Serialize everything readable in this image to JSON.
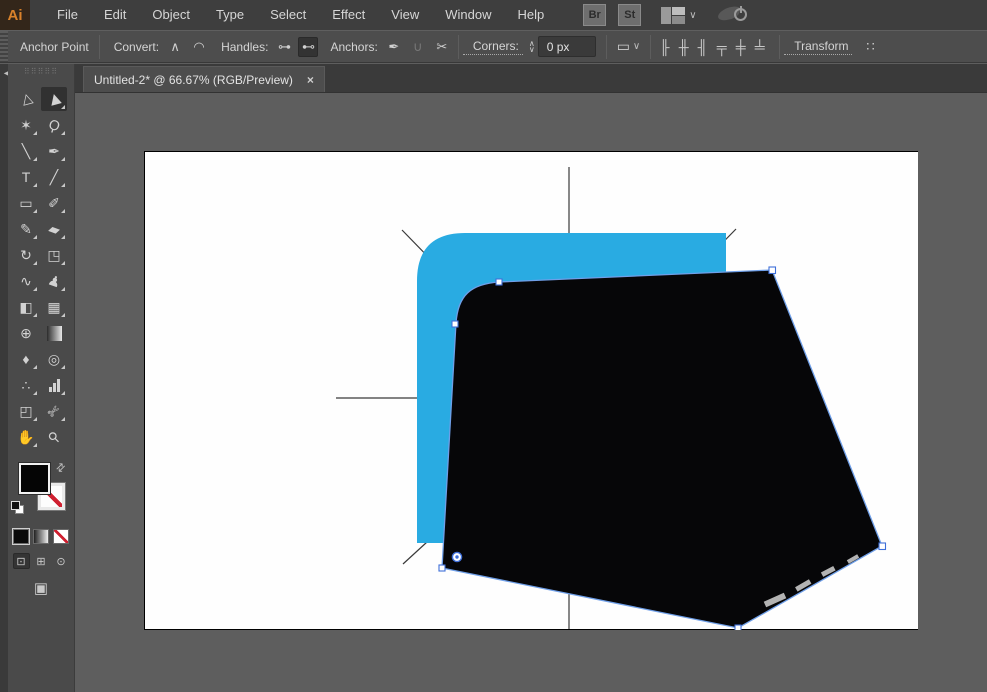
{
  "menu_bar": {
    "logo": "Ai",
    "items": [
      "File",
      "Edit",
      "Object",
      "Type",
      "Select",
      "Effect",
      "View",
      "Window",
      "Help"
    ],
    "bridge_label": "Br",
    "stock_label": "St",
    "workspace_chevron": "∨"
  },
  "control_bar": {
    "context_label": "Anchor Point",
    "convert_label": "Convert:",
    "convert_buttons": [
      {
        "name": "convert-to-corner-button",
        "glyph": "∧"
      },
      {
        "name": "convert-to-smooth-button",
        "glyph": "◠"
      }
    ],
    "handles_label": "Handles:",
    "handle_buttons": [
      {
        "name": "show-handles-button",
        "glyph": "⊶",
        "pressed": false
      },
      {
        "name": "hide-handles-button",
        "glyph": "⊷",
        "pressed": true
      }
    ],
    "anchors_label": "Anchors:",
    "anchor_buttons": [
      {
        "name": "remove-anchor-button",
        "glyph": "✒",
        "dim": false
      },
      {
        "name": "connect-endpoints-button",
        "glyph": "∪",
        "dim": true
      },
      {
        "name": "cut-path-button",
        "glyph": "✂",
        "dim": false
      }
    ],
    "corners_label": "Corners:",
    "corners_value": "0 px",
    "stepper_up": "∧",
    "stepper_down": "∨",
    "shape_props_glyph": "▭",
    "shape_props_chevron": "∨",
    "align_buttons": [
      {
        "name": "align-horizontal-left-button",
        "glyph": "╟"
      },
      {
        "name": "align-horizontal-center-button",
        "glyph": "╫"
      },
      {
        "name": "align-horizontal-right-button",
        "glyph": "╢"
      },
      {
        "name": "align-vertical-top-button",
        "glyph": "╤"
      },
      {
        "name": "align-vertical-center-button",
        "glyph": "╪"
      },
      {
        "name": "align-vertical-bottom-button",
        "glyph": "╧"
      }
    ],
    "transform_label": "Transform",
    "isolate_glyph": "∷"
  },
  "tab": {
    "title": "Untitled-2* @ 66.67% (RGB/Preview)",
    "close_glyph": "×"
  },
  "toolbar": {
    "collapse_glyph": "◄◄",
    "grip_glyph": "⠿⠿⠿⠿⠿",
    "tools": [
      {
        "name": "selection-tool",
        "glyph": "▷",
        "cls": "rot-nw",
        "fly": false,
        "active": false
      },
      {
        "name": "direct-selection-tool",
        "glyph": "▶",
        "cls": "rot-nw",
        "fly": true,
        "active": true
      },
      {
        "name": "magic-wand-tool",
        "glyph": "✶",
        "cls": "",
        "fly": true,
        "active": false
      },
      {
        "name": "lasso-tool",
        "glyph": "Ϙ",
        "cls": "rot-20",
        "fly": true,
        "active": false
      },
      {
        "name": "pen-tool",
        "glyph": "╲",
        "cls": "",
        "fly": true,
        "active": false
      },
      {
        "name": "curvature-tool",
        "glyph": "✒",
        "cls": "",
        "fly": true,
        "active": false
      },
      {
        "name": "type-tool",
        "glyph": "T",
        "cls": "",
        "fly": true,
        "active": false
      },
      {
        "name": "line-segment-tool",
        "glyph": "╱",
        "cls": "",
        "fly": true,
        "active": false
      },
      {
        "name": "rectangle-tool",
        "glyph": "▭",
        "cls": "",
        "fly": true,
        "active": false
      },
      {
        "name": "paintbrush-tool",
        "glyph": "✐",
        "cls": "",
        "fly": true,
        "active": false
      },
      {
        "name": "shaper-tool",
        "glyph": "✎",
        "cls": "",
        "fly": true,
        "active": false
      },
      {
        "name": "eraser-tool",
        "glyph": "▰",
        "cls": "rot-20",
        "fly": true,
        "active": false
      },
      {
        "name": "rotate-tool",
        "glyph": "↻",
        "cls": "",
        "fly": true,
        "active": false
      },
      {
        "name": "shear-tool",
        "glyph": "◳",
        "cls": "",
        "fly": true,
        "active": false
      },
      {
        "name": "width-tool",
        "glyph": "∿",
        "cls": "",
        "fly": true,
        "active": false
      },
      {
        "name": "puppet-warp-tool",
        "glyph": "♟",
        "cls": "rot-20",
        "fly": true,
        "active": false
      },
      {
        "name": "shape-builder-tool",
        "glyph": "◧",
        "cls": "",
        "fly": true,
        "active": false
      },
      {
        "name": "perspective-grid-tool",
        "glyph": "▦",
        "cls": "",
        "fly": true,
        "active": false
      },
      {
        "name": "mesh-tool",
        "glyph": "⊕",
        "cls": "",
        "fly": false,
        "active": false
      },
      {
        "name": "gradient-tool",
        "glyph": "",
        "cls": "gradsq",
        "fly": false,
        "active": false
      },
      {
        "name": "eyedropper-tool",
        "glyph": "♦",
        "cls": "",
        "fly": true,
        "active": false
      },
      {
        "name": "blend-tool",
        "glyph": "◎",
        "cls": "",
        "fly": true,
        "active": false
      },
      {
        "name": "symbol-sprayer-tool",
        "glyph": "∴",
        "cls": "",
        "fly": true,
        "active": false
      },
      {
        "name": "column-graph-tool",
        "glyph": "",
        "cls": "bars",
        "fly": true,
        "active": false
      },
      {
        "name": "artboard-tool",
        "glyph": "◰",
        "cls": "",
        "fly": true,
        "active": false
      },
      {
        "name": "slice-tool",
        "glyph": "✄",
        "cls": "rot-45",
        "fly": true,
        "active": false
      },
      {
        "name": "hand-tool",
        "glyph": "✋",
        "cls": "",
        "fly": true,
        "active": false
      },
      {
        "name": "zoom-tool",
        "glyph": "⚲",
        "cls": "rot-45",
        "fly": false,
        "active": false
      }
    ],
    "swap_glyph": "⇄",
    "mode_buttons": [
      {
        "name": "draw-normal-button",
        "glyph": "⊡",
        "pressed": true
      },
      {
        "name": "draw-behind-button",
        "glyph": "⊞",
        "pressed": false
      },
      {
        "name": "draw-inside-button",
        "glyph": "⊙",
        "pressed": false
      }
    ],
    "screen_mode_glyph": "▣"
  },
  "canvas": {
    "colors": {
      "pasteboard": "#5e5e5e",
      "artboard": "#fefefe",
      "shape_blue": "#29abe2",
      "shape_black": "#060608",
      "selection_stroke": "#6f9fe8",
      "anchor_border": "#3f6fd8",
      "guide_line": "#3a3a3a",
      "smudge": "#c6c6c6"
    }
  }
}
